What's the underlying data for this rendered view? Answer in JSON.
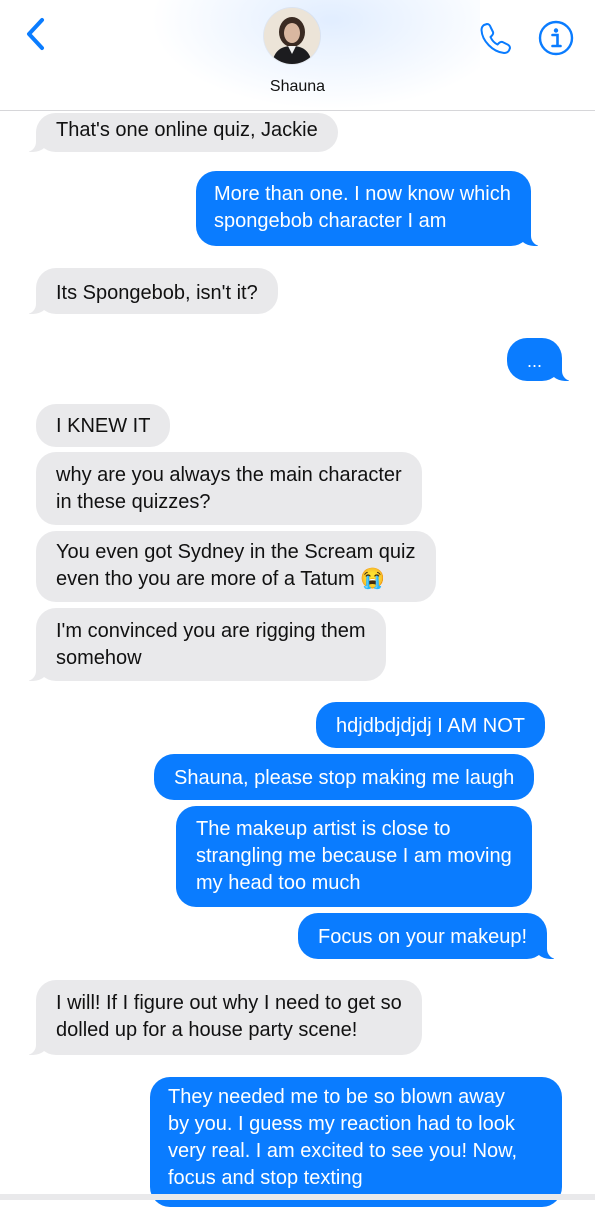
{
  "header": {
    "contact_name": "Shauna",
    "back_icon": "chevron-left-icon",
    "call_icon": "phone-icon",
    "info_icon": "info-icon",
    "accent_color": "#0a7cff"
  },
  "colors": {
    "incoming_bubble": "#e9e9eb",
    "outgoing_bubble": "#0a7cff",
    "background": "#ffffff"
  },
  "messages": [
    {
      "direction": "incoming",
      "lines": [
        "That's one online quiz, Jackie"
      ]
    },
    {
      "direction": "outgoing",
      "lines": [
        "More than one. I now know which",
        "spongebob character I am"
      ]
    },
    {
      "direction": "incoming",
      "lines": [
        "Its Spongebob, isn't it?"
      ]
    },
    {
      "direction": "outgoing",
      "lines": [
        "..."
      ]
    },
    {
      "direction": "incoming",
      "lines": [
        "I KNEW IT"
      ]
    },
    {
      "direction": "incoming",
      "lines": [
        "why are you always the main character",
        "in these quizzes?"
      ]
    },
    {
      "direction": "incoming",
      "lines": [
        "You even got Sydney in the Scream quiz",
        "even tho you are more of a Tatum 😭"
      ]
    },
    {
      "direction": "incoming",
      "lines": [
        "I'm convinced you are rigging them",
        "somehow"
      ]
    },
    {
      "direction": "outgoing",
      "lines": [
        "hdjdbdjdjdj I AM NOT"
      ]
    },
    {
      "direction": "outgoing",
      "lines": [
        "Shauna, please stop making me laugh"
      ]
    },
    {
      "direction": "outgoing",
      "lines": [
        "The makeup artist is close to",
        "strangling me because I am moving",
        "my head too much"
      ]
    },
    {
      "direction": "outgoing",
      "lines": [
        "Focus on your makeup!"
      ]
    },
    {
      "direction": "incoming",
      "lines": [
        "I will! If I figure out why I need to get so",
        "dolled up for a house party scene!"
      ]
    },
    {
      "direction": "outgoing",
      "lines": [
        "They needed me to be so blown away",
        "by you. I guess my reaction had to look",
        "very real. I am excited to see you! Now,",
        "focus and stop texting"
      ]
    }
  ]
}
